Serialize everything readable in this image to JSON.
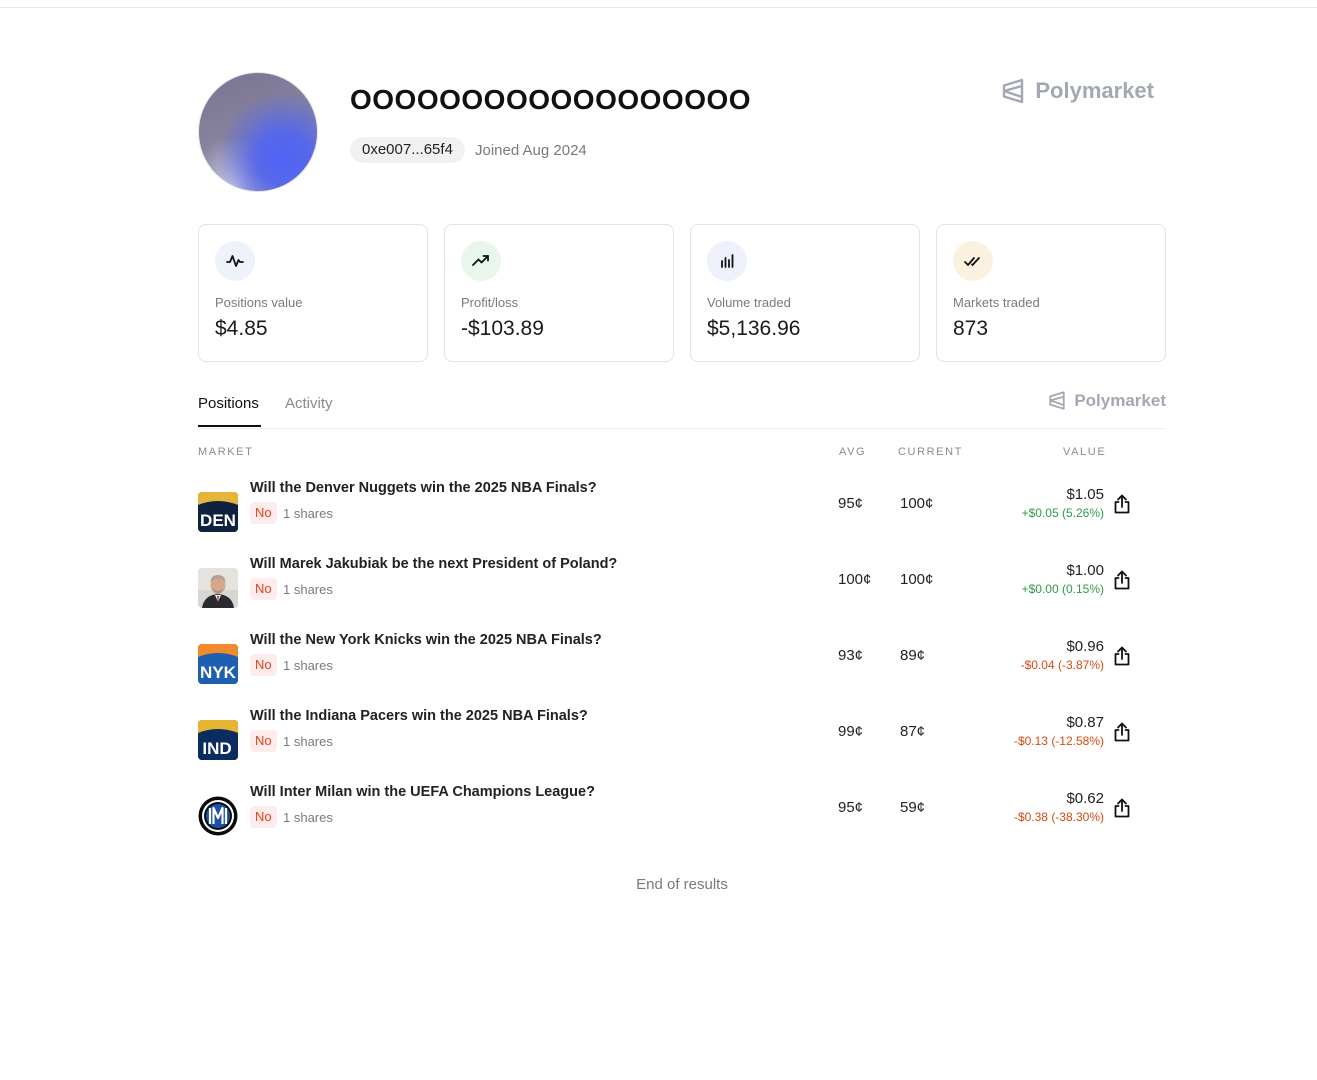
{
  "profile": {
    "username": "OOOOOOOOOOOOOOOOOO",
    "address": "0xe007...65f4",
    "joined": "Joined Aug 2024",
    "brand": "Polymarket"
  },
  "stats": [
    {
      "label": "Positions value",
      "value": "$4.85",
      "icon": "activity-icon",
      "icon_bg": "#eef2fb"
    },
    {
      "label": "Profit/loss",
      "value": "-$103.89",
      "icon": "trending-up-icon",
      "icon_bg": "#e9f6ec"
    },
    {
      "label": "Volume traded",
      "value": "$5,136.96",
      "icon": "bar-chart-icon",
      "icon_bg": "#eef1fb"
    },
    {
      "label": "Markets traded",
      "value": "873",
      "icon": "double-check-icon",
      "icon_bg": "#fbf1e1"
    }
  ],
  "tabs": {
    "positions": "Positions",
    "activity": "Activity",
    "brand": "Polymarket"
  },
  "table": {
    "headers": {
      "market": "MARKET",
      "avg": "AVG",
      "current": "CURRENT",
      "value": "VALUE"
    },
    "rows": [
      {
        "question": "Will the Denver Nuggets win the 2025 NBA Finals?",
        "outcome": "No",
        "shares": "1 shares",
        "avg": "95¢",
        "current": "100¢",
        "value": "$1.05",
        "change": "+$0.05 (5.26%)",
        "direction": "up",
        "thumb": "den-logo"
      },
      {
        "question": "Will Marek Jakubiak be the next President of Poland?",
        "outcome": "No",
        "shares": "1 shares",
        "avg": "100¢",
        "current": "100¢",
        "value": "$1.00",
        "change": "+$0.00 (0.15%)",
        "direction": "up",
        "thumb": "portrait-photo"
      },
      {
        "question": "Will the New York Knicks win the 2025 NBA Finals?",
        "outcome": "No",
        "shares": "1 shares",
        "avg": "93¢",
        "current": "89¢",
        "value": "$0.96",
        "change": "-$0.04 (-3.87%)",
        "direction": "down",
        "thumb": "nyk-logo"
      },
      {
        "question": "Will the Indiana Pacers win the 2025 NBA Finals?",
        "outcome": "No",
        "shares": "1 shares",
        "avg": "99¢",
        "current": "87¢",
        "value": "$0.87",
        "change": "-$0.13 (-12.58%)",
        "direction": "down",
        "thumb": "ind-logo"
      },
      {
        "question": "Will Inter Milan win the UEFA Champions League?",
        "outcome": "No",
        "shares": "1 shares",
        "avg": "95¢",
        "current": "59¢",
        "value": "$0.62",
        "change": "-$0.38 (-38.30%)",
        "direction": "down",
        "thumb": "inter-logo"
      }
    ]
  },
  "thumb_text": {
    "den": "DEN",
    "nyk": "NYK",
    "ind": "IND"
  },
  "footer": {
    "end_text": "End of results"
  },
  "colors": {
    "positive": "#2f9a48",
    "negative": "#d9480f",
    "badge_no": "#e0421c"
  }
}
